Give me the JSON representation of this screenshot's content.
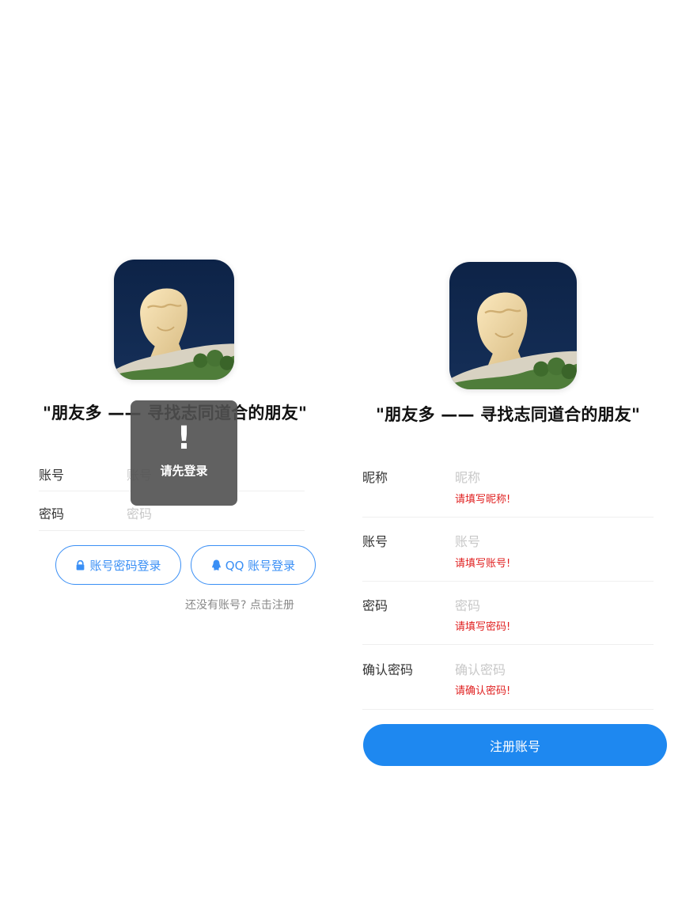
{
  "slogan": "\"朋友多 —— 寻找志同道合的朋友\"",
  "login": {
    "account_label": "账号",
    "account_placeholder": "账号",
    "password_label": "密码",
    "password_placeholder": "密码",
    "password_login_button": "账号密码登录",
    "qq_login_button": "QQ 账号登录",
    "register_link": "还没有账号? 点击注册",
    "toast": {
      "icon": "exclamation-icon",
      "mark": "!",
      "text": "请先登录"
    }
  },
  "register": {
    "fields": [
      {
        "label": "昵称",
        "placeholder": "昵称",
        "error": "请填写昵称!"
      },
      {
        "label": "账号",
        "placeholder": "账号",
        "error": "请填写账号!"
      },
      {
        "label": "密码",
        "placeholder": "密码",
        "error": "请填写密码!"
      },
      {
        "label": "确认密码",
        "placeholder": "确认密码",
        "error": "请确认密码!"
      }
    ],
    "submit_button": "注册账号"
  },
  "colors": {
    "accent": "#1e88f0",
    "outline": "#3a8ff5",
    "error": "#e02020",
    "toast_bg": "#505050"
  }
}
